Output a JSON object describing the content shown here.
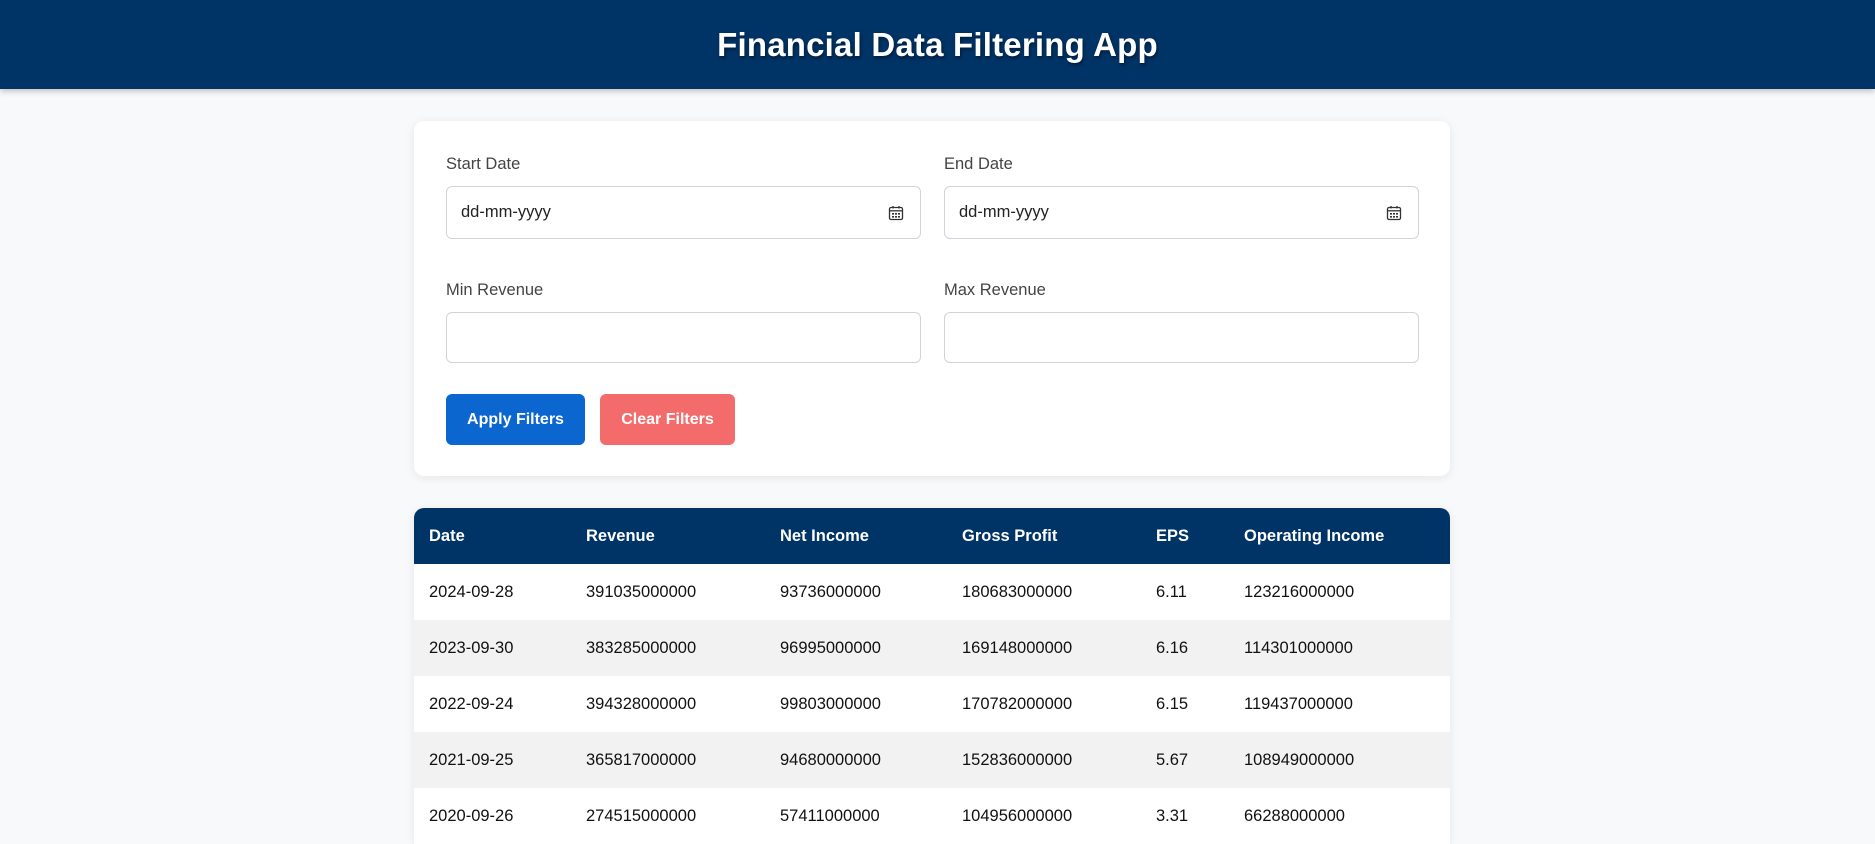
{
  "header": {
    "title": "Financial Data Filtering App"
  },
  "filters": {
    "start_date": {
      "label": "Start Date",
      "value": "dd-mm-yyyy",
      "icon": "calendar-icon"
    },
    "end_date": {
      "label": "End Date",
      "value": "dd-mm-yyyy",
      "icon": "calendar-icon"
    },
    "min_revenue": {
      "label": "Min Revenue",
      "value": ""
    },
    "max_revenue": {
      "label": "Max Revenue",
      "value": ""
    },
    "apply_label": "Apply Filters",
    "clear_label": "Clear Filters"
  },
  "colors": {
    "header_bg": "#003366",
    "apply_button": "#0b66d0",
    "clear_button": "#f46b6b"
  },
  "table": {
    "columns": [
      "Date",
      "Revenue",
      "Net Income",
      "Gross Profit",
      "EPS",
      "Operating Income"
    ],
    "rows": [
      [
        "2024-09-28",
        "391035000000",
        "93736000000",
        "180683000000",
        "6.11",
        "123216000000"
      ],
      [
        "2023-09-30",
        "383285000000",
        "96995000000",
        "169148000000",
        "6.16",
        "114301000000"
      ],
      [
        "2022-09-24",
        "394328000000",
        "99803000000",
        "170782000000",
        "6.15",
        "119437000000"
      ],
      [
        "2021-09-25",
        "365817000000",
        "94680000000",
        "152836000000",
        "5.67",
        "108949000000"
      ],
      [
        "2020-09-26",
        "274515000000",
        "57411000000",
        "104956000000",
        "3.31",
        "66288000000"
      ]
    ]
  }
}
